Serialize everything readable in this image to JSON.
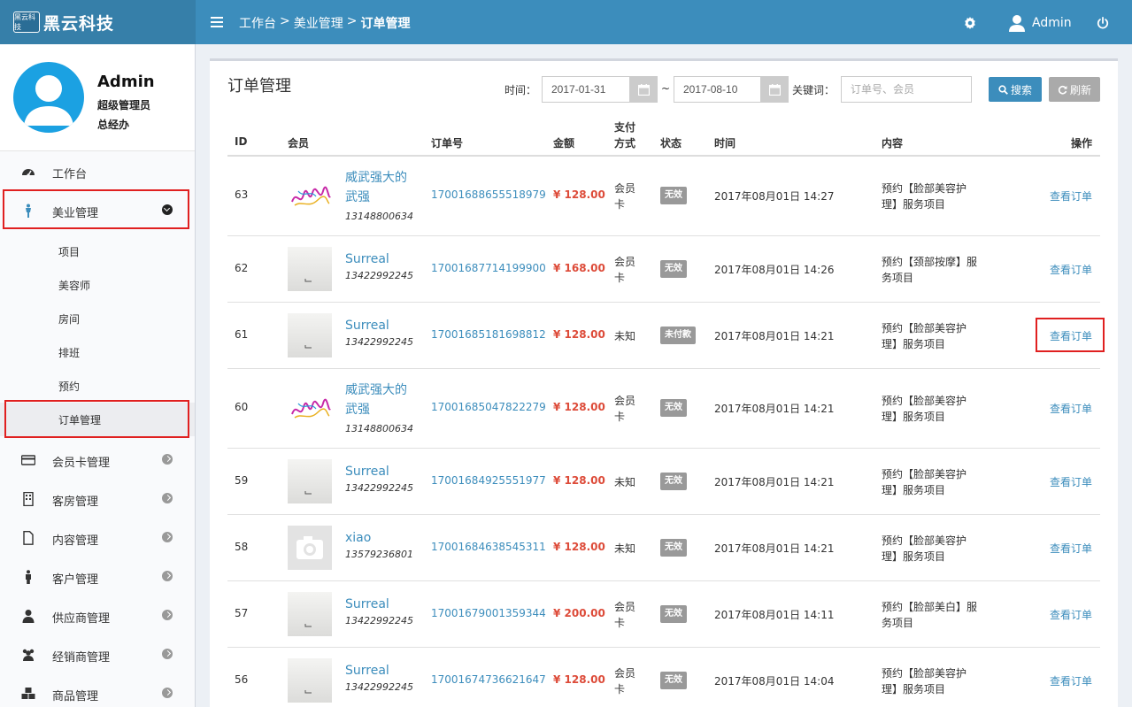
{
  "brand": {
    "logo_text": "黑云科技",
    "name": "黑云科技"
  },
  "breadcrumb": {
    "items": [
      "工作台",
      "美业管理",
      "订单管理"
    ],
    "separator": ">"
  },
  "topbar": {
    "user": "Admin"
  },
  "profile": {
    "name": "Admin",
    "role": "超级管理员",
    "department": "总经办"
  },
  "sidebar": {
    "items": [
      {
        "label": "工作台",
        "icon": "dashboard-icon"
      },
      {
        "label": "美业管理",
        "icon": "person-icon"
      },
      {
        "label": "会员卡管理",
        "icon": "credit-card-icon"
      },
      {
        "label": "客房管理",
        "icon": "building-icon"
      },
      {
        "label": "内容管理",
        "icon": "file-icon"
      },
      {
        "label": "客户管理",
        "icon": "male-icon"
      },
      {
        "label": "供应商管理",
        "icon": "user-icon"
      },
      {
        "label": "经销商管理",
        "icon": "users-icon"
      },
      {
        "label": "商品管理",
        "icon": "cubes-icon"
      }
    ],
    "subitems": [
      "项目",
      "美容师",
      "房间",
      "排班",
      "预约",
      "订单管理"
    ]
  },
  "page": {
    "title": "订单管理"
  },
  "filters": {
    "time_label": "时间：",
    "date_from": "2017-01-31",
    "tilde": "~",
    "date_to": "2017-08-10",
    "keyword_label": "关键词：",
    "keyword_placeholder": "订单号、会员",
    "search_label": "搜索",
    "refresh_label": "刷新"
  },
  "table": {
    "headers": {
      "id": "ID",
      "member": "会员",
      "order_no": "订单号",
      "amount": "金额",
      "pay_line1": "支付",
      "pay_line2": "方式",
      "status": "状态",
      "time": "时间",
      "content": "内容",
      "action": "操作"
    },
    "rows": [
      {
        "id": "63",
        "name": "威武强大的武强",
        "name_l1": "威武强大的",
        "name_l2": "武强",
        "phone": "13148800634",
        "avatar": "signature",
        "order_no": "17001688655518979",
        "amount": "¥ 128.00",
        "pay_l1": "会员",
        "pay_l2": "卡",
        "status": "无效",
        "time": "2017年08月01日 14:27",
        "content_l1": "预约【脸部美容护",
        "content_l2": "理】服务项目",
        "action": "查看订单"
      },
      {
        "id": "62",
        "name": "Surreal",
        "name_l1": "Surreal",
        "name_l2": "",
        "phone": "13422992245",
        "avatar": "gray",
        "order_no": "17001687714199900",
        "amount": "¥ 168.00",
        "pay_l1": "会员",
        "pay_l2": "卡",
        "status": "无效",
        "time": "2017年08月01日 14:26",
        "content_l1": "预约【颈部按摩】服",
        "content_l2": "务项目",
        "action": "查看订单"
      },
      {
        "id": "61",
        "name": "Surreal",
        "name_l1": "Surreal",
        "name_l2": "",
        "phone": "13422992245",
        "avatar": "gray",
        "order_no": "17001685181698812",
        "amount": "¥ 128.00",
        "pay_l1": "未知",
        "pay_l2": "",
        "status": "未付款",
        "time": "2017年08月01日 14:21",
        "content_l1": "预约【脸部美容护",
        "content_l2": "理】服务项目",
        "action": "查看订单"
      },
      {
        "id": "60",
        "name": "威武强大的武强",
        "name_l1": "威武强大的",
        "name_l2": "武强",
        "phone": "13148800634",
        "avatar": "signature",
        "order_no": "17001685047822279",
        "amount": "¥ 128.00",
        "pay_l1": "会员",
        "pay_l2": "卡",
        "status": "无效",
        "time": "2017年08月01日 14:21",
        "content_l1": "预约【脸部美容护",
        "content_l2": "理】服务项目",
        "action": "查看订单"
      },
      {
        "id": "59",
        "name": "Surreal",
        "name_l1": "Surreal",
        "name_l2": "",
        "phone": "13422992245",
        "avatar": "gray",
        "order_no": "17001684925551977",
        "amount": "¥ 128.00",
        "pay_l1": "未知",
        "pay_l2": "",
        "status": "无效",
        "time": "2017年08月01日 14:21",
        "content_l1": "预约【脸部美容护",
        "content_l2": "理】服务项目",
        "action": "查看订单"
      },
      {
        "id": "58",
        "name": "xiao",
        "name_l1": "xiao",
        "name_l2": "",
        "phone": "13579236801",
        "avatar": "camera",
        "order_no": "17001684638545311",
        "amount": "¥ 128.00",
        "pay_l1": "未知",
        "pay_l2": "",
        "status": "无效",
        "time": "2017年08月01日 14:21",
        "content_l1": "预约【脸部美容护",
        "content_l2": "理】服务项目",
        "action": "查看订单"
      },
      {
        "id": "57",
        "name": "Surreal",
        "name_l1": "Surreal",
        "name_l2": "",
        "phone": "13422992245",
        "avatar": "gray",
        "order_no": "17001679001359344",
        "amount": "¥ 200.00",
        "pay_l1": "会员",
        "pay_l2": "卡",
        "status": "无效",
        "time": "2017年08月01日 14:11",
        "content_l1": "预约【脸部美白】服",
        "content_l2": "务项目",
        "action": "查看订单"
      },
      {
        "id": "56",
        "name": "Surreal",
        "name_l1": "Surreal",
        "name_l2": "",
        "phone": "13422992245",
        "avatar": "gray",
        "order_no": "17001674736621647",
        "amount": "¥ 128.00",
        "pay_l1": "会员",
        "pay_l2": "卡",
        "status": "无效",
        "time": "2017年08月01日 14:04",
        "content_l1": "预约【脸部美容护",
        "content_l2": "理】服务项目",
        "action": "查看订单"
      }
    ]
  },
  "colors": {
    "primary": "#3c8dbc",
    "brand_dark": "#367fa9",
    "amount": "#dd4b39",
    "badge": "#999999",
    "highlight": "#e02020"
  }
}
